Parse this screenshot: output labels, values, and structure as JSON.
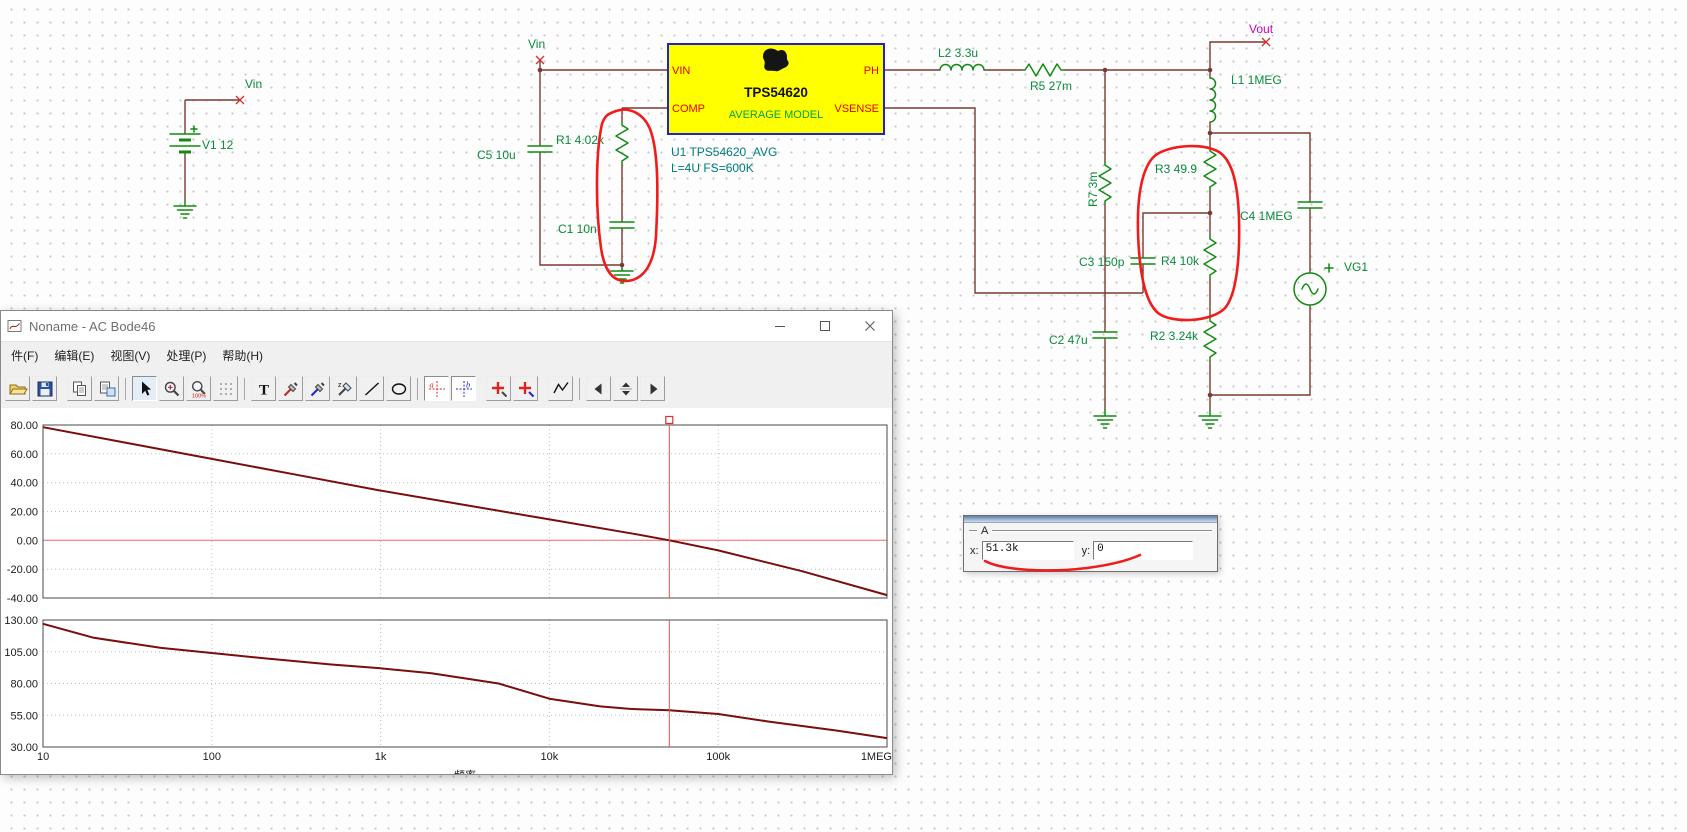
{
  "schematic": {
    "labels": {
      "vin_source_tag": "Vin",
      "v1": "V1 12",
      "vin_node_tag": "Vin",
      "c5": "C5 10u",
      "r1": "R1 4.02k",
      "c1": "C1 10n",
      "l2": "L2 3.3u",
      "r5": "R5 27m",
      "r7": "R7 3m",
      "c3": "C3 150p",
      "c2": "C2 47u",
      "r3": "R3 49.9",
      "r4": "R4 10k",
      "r2": "R2 3.24k",
      "l1": "L1 1MEG",
      "c4": "C4 1MEG",
      "vg1": "VG1",
      "vout_tag": "Vout",
      "u1_ref": "U1 TPS54620_AVG",
      "u1_params": "L=4U FS=600K"
    },
    "ic": {
      "title": "TPS54620",
      "subtitle": "AVERAGE MODEL",
      "pins": {
        "vin": "VIN",
        "comp": "COMP",
        "ph": "PH",
        "vsense": "VSENSE"
      }
    },
    "colors": {
      "wire": "#7b3a30",
      "component": "#128a12",
      "label": "#0a8a3c",
      "pin_text": "#e00000",
      "ic_fill": "#ffff00",
      "ic_border": "#2222cc",
      "vout_label": "#c400c4",
      "annotation_ink": "#f11b1b"
    }
  },
  "bode_window": {
    "title": "Noname - AC Bode46",
    "menu": [
      "件(F)",
      "编辑(E)",
      "视图(V)",
      "处理(P)",
      "帮助(H)"
    ],
    "toolbar": [
      {
        "icon": "open-icon"
      },
      {
        "icon": "save-icon"
      },
      {
        "type": "gap"
      },
      {
        "icon": "copy-icon"
      },
      {
        "icon": "copy-special-icon"
      },
      {
        "type": "sep"
      },
      {
        "icon": "select-arrow-icon",
        "pressed": true
      },
      {
        "icon": "zoom-in-icon"
      },
      {
        "icon": "zoom-100-icon"
      },
      {
        "icon": "grid-icon"
      },
      {
        "type": "sep"
      },
      {
        "icon": "text-icon"
      },
      {
        "icon": "probe-red-icon"
      },
      {
        "icon": "probe-blue-icon"
      },
      {
        "icon": "impedance-probe-icon"
      },
      {
        "icon": "line-icon"
      },
      {
        "icon": "ellipse-icon"
      },
      {
        "type": "sep"
      },
      {
        "icon": "cursor-a-icon",
        "framed": true
      },
      {
        "icon": "cursor-b-icon",
        "framed": true
      },
      {
        "type": "gap"
      },
      {
        "icon": "marker-red-icon"
      },
      {
        "icon": "marker-blue-icon"
      },
      {
        "type": "gap"
      },
      {
        "icon": "polyline-icon"
      },
      {
        "type": "sep"
      },
      {
        "icon": "nav-left-icon"
      },
      {
        "icon": "nav-spin-icon"
      },
      {
        "icon": "nav-right-icon"
      }
    ]
  },
  "cursor_panel": {
    "group": "A",
    "x_label": "x:",
    "x_value": "51.3k",
    "y_label": "y:",
    "y_value": "0"
  },
  "chart_data": [
    {
      "type": "line",
      "name": "gain",
      "xscale": "log",
      "xlim": [
        10,
        1000000
      ],
      "ylim": [
        -40,
        80
      ],
      "yticks": [
        80,
        60,
        40,
        20,
        0,
        -20,
        -40
      ],
      "ytick_labels": [
        "80.00",
        "60.00",
        "40.00",
        "20.00",
        "0.00",
        "-20.00",
        "-40.00"
      ],
      "xtick_labels": [
        "10",
        "100",
        "1k",
        "10k",
        "100k",
        "1MEG"
      ],
      "x": [
        10,
        31.6,
        100,
        316,
        1000,
        3162,
        10000,
        31600,
        51300,
        100000,
        316000,
        1000000
      ],
      "y": [
        78.5,
        67.5,
        56.5,
        45.5,
        34.5,
        24.5,
        14.5,
        4.5,
        0,
        -7,
        -21.5,
        -38
      ],
      "ref_line": 0,
      "cursor_x": 51300,
      "grid": true,
      "legend": "none"
    },
    {
      "type": "line",
      "name": "phase",
      "xscale": "log",
      "xlim": [
        10,
        1000000
      ],
      "ylim": [
        30,
        130
      ],
      "yticks": [
        130,
        105,
        80,
        55,
        30
      ],
      "ytick_labels": [
        "130.00",
        "105.00",
        "80.00",
        "55.00",
        "30.00"
      ],
      "xtick_labels": [
        "10",
        "100",
        "1k",
        "10k",
        "100k",
        "1MEG"
      ],
      "xlabel": "频率",
      "x": [
        10,
        20,
        50,
        100,
        200,
        500,
        1000,
        2000,
        5000,
        10000,
        20000,
        30000,
        51300,
        100000,
        200000,
        500000,
        1000000
      ],
      "y": [
        127,
        116,
        108,
        104,
        100,
        95,
        92,
        88,
        80,
        68,
        62,
        60,
        59,
        56,
        50,
        43,
        37
      ],
      "cursor_x": 51300,
      "grid": true,
      "legend": "none"
    }
  ]
}
